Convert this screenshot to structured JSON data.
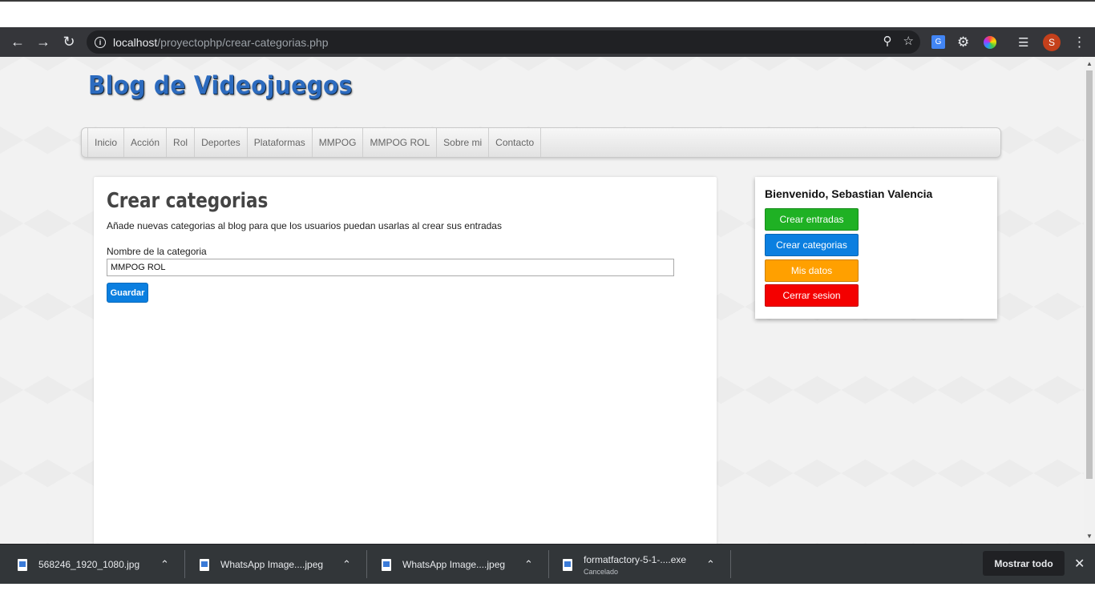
{
  "browser": {
    "url_host": "localhost",
    "url_path": "/proyectophp/crear-categorias.php",
    "avatar_letter": "S"
  },
  "site": {
    "title": "Blog de Videojuegos",
    "menu": [
      "Inicio",
      "Acción",
      "Rol",
      "Deportes",
      "Plataformas",
      "MMPOG",
      "MMPOG ROL",
      "Sobre mi",
      "Contacto"
    ]
  },
  "main": {
    "title": "Crear categorias",
    "description": "Añade nuevas categorias al blog para que los usuarios puedan usarlas al crear sus entradas",
    "field_label": "Nombre de la categoria",
    "field_value": "MMPOG ROL",
    "save_label": "Guardar"
  },
  "sidebar": {
    "welcome": "Bienvenido, Sebastian Valencia",
    "buttons": [
      {
        "label": "Crear entradas",
        "color": "#1fb124"
      },
      {
        "label": "Crear categorias",
        "color": "#0b7fe0"
      },
      {
        "label": "Mis datos",
        "color": "#ffa000"
      },
      {
        "label": "Cerrar sesion",
        "color": "#f40000"
      }
    ]
  },
  "downloads": {
    "items": [
      {
        "name": "568246_1920_1080.jpg",
        "status": ""
      },
      {
        "name": "WhatsApp Image....jpeg",
        "status": ""
      },
      {
        "name": "WhatsApp Image....jpeg",
        "status": ""
      },
      {
        "name": "formatfactory-5-1-....exe",
        "status": "Cancelado"
      }
    ],
    "show_all": "Mostrar todo"
  }
}
